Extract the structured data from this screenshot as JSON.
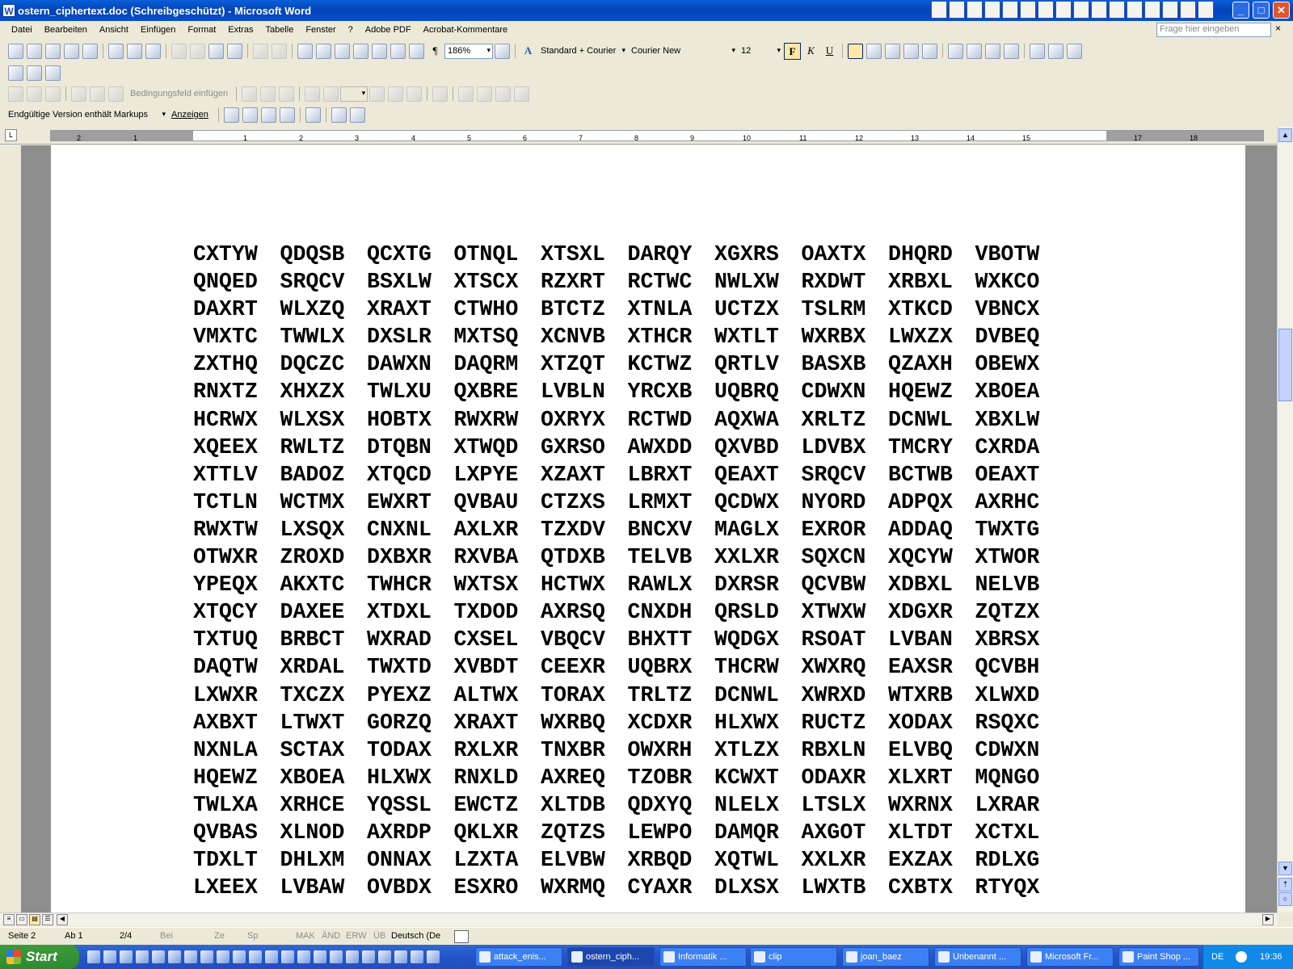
{
  "window": {
    "title": "ostern_ciphertext.doc (Schreibgeschützt) - Microsoft Word",
    "app_icon": "W",
    "minimize": "_",
    "maximize": "□",
    "close": "✕"
  },
  "menu": [
    "Datei",
    "Bearbeiten",
    "Ansicht",
    "Einfügen",
    "Format",
    "Extras",
    "Tabelle",
    "Fenster",
    "?",
    "Adobe PDF",
    "Acrobat-Kommentare"
  ],
  "help_box": {
    "placeholder": "Frage hier eingeben",
    "close": "×"
  },
  "standard_toolbar": {
    "zoom": "186%",
    "paragraph_mark": "¶"
  },
  "format_toolbar": {
    "style": "Standard + Courier",
    "font": "Courier New",
    "size": "12",
    "bold": "F",
    "italic": "K",
    "underline": "U",
    "style_icon": "A"
  },
  "mailmerge_toolbar": {
    "condition_field": "Bedingungsfeld einfügen"
  },
  "review_toolbar": {
    "markup_view": "Endgültige Version enthält Markups",
    "show": "Anzeigen"
  },
  "ruler": {
    "tab_marker": "L",
    "numbers": [
      "2",
      "1",
      "1",
      "2",
      "3",
      "4",
      "5",
      "6",
      "7",
      "8",
      "9",
      "10",
      "11",
      "12",
      "13",
      "14",
      "15",
      "17",
      "18"
    ]
  },
  "document": {
    "cipher_rows": [
      [
        "CXTYW",
        "QDQSB",
        "QCXTG",
        "OTNQL",
        "XTSXL",
        "DARQY",
        "XGXRS",
        "OAXTX",
        "DHQRD",
        "VBOTW"
      ],
      [
        "QNQED",
        "SRQCV",
        "BSXLW",
        "XTSCX",
        "RZXRT",
        "RCTWC",
        "NWLXW",
        "RXDWT",
        "XRBXL",
        "WXKCO"
      ],
      [
        "DAXRT",
        "WLXZQ",
        "XRAXT",
        "CTWHO",
        "BTCTZ",
        "XTNLA",
        "UCTZX",
        "TSLRM",
        "XTKCD",
        "VBNCX"
      ],
      [
        "VMXTC",
        "TWWLX",
        "DXSLR",
        "MXTSQ",
        "XCNVB",
        "XTHCR",
        "WXTLT",
        "WXRBX",
        "LWXZX",
        "DVBEQ"
      ],
      [
        "ZXTHQ",
        "DQCZC",
        "DAWXN",
        "DAQRM",
        "XTZQT",
        "KCTWZ",
        "QRTLV",
        "BASXB",
        "QZAXH",
        "OBEWX"
      ],
      [
        "RNXTZ",
        "XHXZX",
        "TWLXU",
        "QXBRE",
        "LVBLN",
        "YRCXB",
        "UQBRQ",
        "CDWXN",
        "HQEWZ",
        "XBOEA"
      ],
      [
        "HCRWX",
        "WLXSX",
        "HOBTX",
        "RWXRW",
        "OXRYX",
        "RCTWD",
        "AQXWA",
        "XRLTZ",
        "DCNWL",
        "XBXLW"
      ],
      [
        "XQEEX",
        "RWLTZ",
        "DTQBN",
        "XTWQD",
        "GXRSO",
        "AWXDD",
        "QXVBD",
        "LDVBX",
        "TMCRY",
        "CXRDA"
      ],
      [
        "XTTLV",
        "BADOZ",
        "XTQCD",
        "LXPYE",
        "XZAXT",
        "LBRXT",
        "QEAXT",
        "SRQCV",
        "BCTWB",
        "OEAXT"
      ],
      [
        "TCTLN",
        "WCTMX",
        "EWXRT",
        "QVBAU",
        "CTZXS",
        "LRMXT",
        "QCDWX",
        "NYORD",
        "ADPQX",
        "AXRHC"
      ],
      [
        "RWXTW",
        "LXSQX",
        "CNXNL",
        "AXLXR",
        "TZXDV",
        "BNCXV",
        "MAGLX",
        "EXROR",
        "ADDAQ",
        "TWXTG"
      ],
      [
        "OTWXR",
        "ZROXD",
        "DXBXR",
        "RXVBA",
        "QTDXB",
        "TELVB",
        "XXLXR",
        "SQXCN",
        "XQCYW",
        "XTWOR"
      ],
      [
        "YPEQX",
        "AKXTC",
        "TWHCR",
        "WXTSX",
        "HCTWX",
        "RAWLX",
        "DXRSR",
        "QCVBW",
        "XDBXL",
        "NELVB"
      ],
      [
        "XTQCY",
        "DAXEE",
        "XTDXL",
        "TXDOD",
        "AXRSQ",
        "CNXDH",
        "QRSLD",
        "XTWXW",
        "XDGXR",
        "ZQTZX"
      ],
      [
        "TXTUQ",
        "BRBCT",
        "WXRAD",
        "CXSEL",
        "VBQCV",
        "BHXTT",
        "WQDGX",
        "RSOAT",
        "LVBAN",
        "XBRSX"
      ],
      [
        "DAQTW",
        "XRDAL",
        "TWXTD",
        "XVBDT",
        "CEEXR",
        "UQBRX",
        "THCRW",
        "XWXRQ",
        "EAXSR",
        "QCVBH"
      ],
      [
        "LXWXR",
        "TXCZX",
        "PYEXZ",
        "ALTWX",
        "TORAX",
        "TRLTZ",
        "DCNWL",
        "XWRXD",
        "WTXRB",
        "XLWXD"
      ],
      [
        "AXBXT",
        "LTWXT",
        "GORZQ",
        "XRAXT",
        "WXRBQ",
        "XCDXR",
        "HLXWX",
        "RUCTZ",
        "XODAX",
        "RSQXC"
      ],
      [
        "NXNLA",
        "SCTAX",
        "TODAX",
        "RXLXR",
        "TNXBR",
        "OWXRH",
        "XTLZX",
        "RBXLN",
        "ELVBQ",
        "CDWXN"
      ],
      [
        "HQEWZ",
        "XBOEA",
        "HLXWX",
        "RNXLD",
        "AXREQ",
        "TZOBR",
        "KCWXT",
        "ODAXR",
        "XLXRT",
        "MQNGO"
      ],
      [
        "TWLXA",
        "XRHCE",
        "YQSSL",
        "EWCTZ",
        "XLTDB",
        "QDXYQ",
        "NLELX",
        "LTSLX",
        "WXRNX",
        "LXRAR"
      ],
      [
        "QVBAS",
        "XLNOD",
        "AXRDP",
        "QKLXR",
        "ZQTZS",
        "LEWPO",
        "DAMQR",
        "AXGOT",
        "XLTDT",
        "XCTXL"
      ],
      [
        "TDXLT",
        "DHLXM",
        "ONNAX",
        "LZXTA",
        "ELVBW",
        "XRBQD",
        "XQTWL",
        "XXLXR",
        "EXZAX",
        "RDLXG"
      ],
      [
        "LXEEX",
        "LVBAW",
        "OVBDX",
        "ESXRO",
        "WXRMQ",
        "CYAXR",
        "DLXSX",
        "LWXTB",
        "CXBTX",
        "RTYQX"
      ]
    ]
  },
  "status": {
    "page": "Seite 2",
    "section": "Ab 1",
    "page_of": "2/4",
    "at": "Bei",
    "line": "Ze",
    "column": "Sp",
    "rec": "MAK",
    "track": "ÄND",
    "ext": "ERW",
    "ovr": "ÜB",
    "language": "Deutsch (De"
  },
  "taskbar": {
    "start": "Start",
    "tasks": [
      "attack_enis...",
      "ostern_ciph...",
      "Informatik ...",
      "clip",
      "joan_baez",
      "Unbenannt ...",
      "Microsoft Fr...",
      "Paint Shop ..."
    ],
    "lang": "DE",
    "clock": "19:36"
  }
}
